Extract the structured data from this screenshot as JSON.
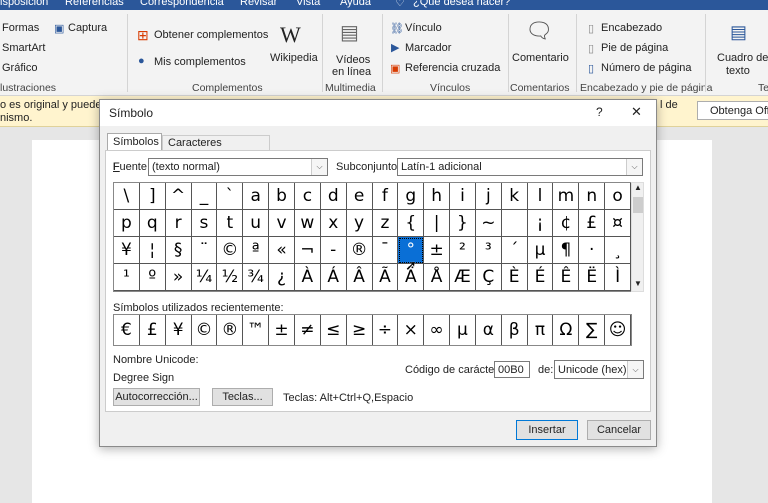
{
  "ribbon_tabs": [
    "isposición",
    "Referencias",
    "Correspondencia",
    "Revisar",
    "Vista",
    "Ayuda",
    "¿Qué desea hacer?"
  ],
  "ribbon": {
    "illustraciones": {
      "formas": "Formas",
      "captura": "Captura",
      "smartart": "SmartArt",
      "grafico": "Gráfico",
      "label": "lustraciones"
    },
    "complementos": {
      "obtener": "Obtener complementos",
      "mis": "Mis complementos",
      "wikipedia": "Wikipedia",
      "label": "Complementos"
    },
    "multimedia": {
      "videos1": "Vídeos",
      "videos2": "en línea",
      "label": "Multimedia"
    },
    "vinculos": {
      "vinculo": "Vínculo",
      "marcador": "Marcador",
      "referencia": "Referencia cruzada",
      "label": "Vínculos"
    },
    "comentarios": {
      "comentario": "Comentario",
      "label": "Comentarios"
    },
    "encabezado": {
      "encabezado": "Encabezado",
      "pie": "Pie de página",
      "numero": "Número de página",
      "label": "Encabezado y pie de página"
    },
    "texto": {
      "cuadro1": "Cuadro de",
      "cuadro2": "texto",
      "label": "Te"
    }
  },
  "message_bar": {
    "line1": "o es original y puede s",
    "line1_right": "l de",
    "line2": "nismo.",
    "button": "Obtenga Offi"
  },
  "dialog": {
    "title": "Símbolo",
    "help": "?",
    "close": "✕",
    "tabs": [
      "Símbolos",
      "Caracteres especiales"
    ],
    "font_label": "Fuente:",
    "font_value": "(texto normal)",
    "subset_label": "Subconjunto:",
    "subset_value": "Latín-1 adicional",
    "symbols": [
      "\\",
      "]",
      "^",
      "_",
      "`",
      "a",
      "b",
      "c",
      "d",
      "e",
      "f",
      "g",
      "h",
      "i",
      "j",
      "k",
      "l",
      "m",
      "n",
      "o",
      "p",
      "q",
      "r",
      "s",
      "t",
      "u",
      "v",
      "w",
      "x",
      "y",
      "z",
      "{",
      "|",
      "}",
      "~",
      "",
      "¡",
      "¢",
      "£",
      "¤",
      "¥",
      "¦",
      "§",
      "¨",
      "©",
      "ª",
      "«",
      "¬",
      "-",
      "®",
      "¯",
      "°",
      "±",
      "²",
      "³",
      "´",
      "µ",
      "¶",
      "·",
      "¸",
      "¹",
      "º",
      "»",
      "¼",
      "½",
      "¾",
      "¿",
      "À",
      "Á",
      "Â",
      "Ã",
      "Ä",
      "Å",
      "Æ",
      "Ç",
      "È",
      "É",
      "Ê",
      "Ë",
      "Ì"
    ],
    "selected_index": 51,
    "recent_label": "Símbolos utilizados recientemente:",
    "recent": [
      "€",
      "£",
      "¥",
      "©",
      "®",
      "™",
      "±",
      "≠",
      "≤",
      "≥",
      "÷",
      "×",
      "∞",
      "µ",
      "α",
      "β",
      "π",
      "Ω",
      "∑",
      "☺"
    ],
    "unicode_name_label": "Nombre Unicode:",
    "unicode_name": "Degree Sign",
    "char_code_label": "Código de carácter:",
    "char_code": "00B0",
    "from_label": "de:",
    "from_value": "Unicode (hex)",
    "autocorrect": "Autocorrección...",
    "keys": "Teclas...",
    "shortcut": "Teclas: Alt+Ctrl+Q,Espacio",
    "insert": "Insertar",
    "cancel": "Cancelar"
  }
}
